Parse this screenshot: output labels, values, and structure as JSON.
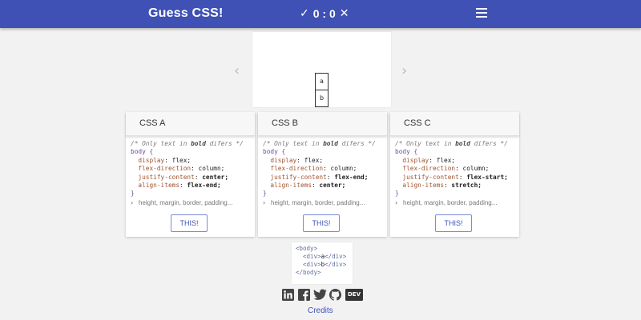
{
  "app": {
    "title": "Guess CSS!",
    "score": "0 : 0"
  },
  "preview": {
    "box_a": "a",
    "box_b": "b"
  },
  "cards": [
    {
      "title": "CSS A",
      "comment": "/* Only text in ",
      "comment_bold": "bold",
      "comment_end": " difers */",
      "selector": "body {",
      "lines": [
        {
          "prop": "display",
          "val": "flex;",
          "bold": false
        },
        {
          "prop": "flex-direction",
          "val": "column;",
          "bold": false
        },
        {
          "prop": "justify-content",
          "val": "center;",
          "bold": true
        },
        {
          "prop": "align-items",
          "val": "flex-end;",
          "bold": true
        }
      ],
      "close": "}",
      "hint": "height, margin, border, padding...",
      "button": "THIS!"
    },
    {
      "title": "CSS B",
      "comment": "/* Only text in ",
      "comment_bold": "bold",
      "comment_end": " difers */",
      "selector": "body {",
      "lines": [
        {
          "prop": "display",
          "val": "flex;",
          "bold": false
        },
        {
          "prop": "flex-direction",
          "val": "column;",
          "bold": false
        },
        {
          "prop": "justify-content",
          "val": "flex-end;",
          "bold": true
        },
        {
          "prop": "align-items",
          "val": "center;",
          "bold": true
        }
      ],
      "close": "}",
      "hint": "height, margin, border, padding...",
      "button": "THIS!"
    },
    {
      "title": "CSS C",
      "comment": "/* Only text in ",
      "comment_bold": "bold",
      "comment_end": " difers */",
      "selector": "body {",
      "lines": [
        {
          "prop": "display",
          "val": "flex;",
          "bold": false
        },
        {
          "prop": "flex-direction",
          "val": "column;",
          "bold": false
        },
        {
          "prop": "justify-content",
          "val": "flex-start;",
          "bold": true
        },
        {
          "prop": "align-items",
          "val": "stretch;",
          "bold": true
        }
      ],
      "close": "}",
      "hint": "height, margin, border, padding...",
      "button": "THIS!"
    }
  ],
  "html_snippet": {
    "open": "<body>",
    "line1_pre": "  <div>",
    "line1_letter": "a",
    "line1_post": "</div>",
    "line2_pre": "  <div>",
    "line2_letter": "b",
    "line2_post": "</div>",
    "close": "</body>"
  },
  "footer": {
    "social_icons": [
      "linkedin-icon",
      "facebook-icon",
      "twitter-icon",
      "github-icon",
      "dev-icon"
    ],
    "dev_label": "DEV",
    "credits": "Credits"
  },
  "colors": {
    "header": "#3f51b5",
    "accent": "#3f51b5",
    "background": "#f2f2f2"
  }
}
